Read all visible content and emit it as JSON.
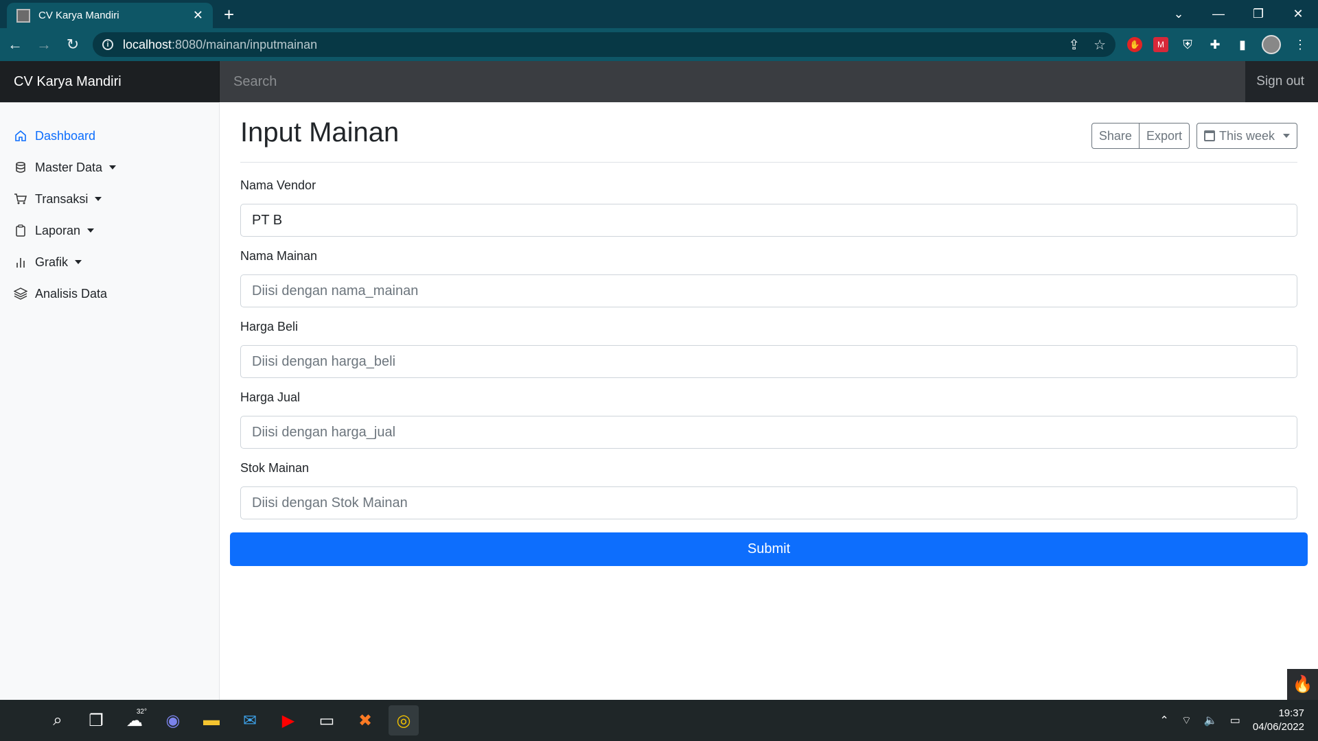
{
  "browser": {
    "tab_title": "CV Karya Mandiri",
    "url_host": "localhost",
    "url_path": ":8080/mainan/inputmainan"
  },
  "app": {
    "brand": "CV Karya Mandiri",
    "search_placeholder": "Search",
    "signout_label": "Sign out"
  },
  "sidebar": {
    "items": [
      {
        "label": "Dashboard",
        "icon": "home-icon",
        "active": true
      },
      {
        "label": "Master Data",
        "icon": "database-icon",
        "dropdown": true
      },
      {
        "label": "Transaksi",
        "icon": "cart-icon",
        "dropdown": true
      },
      {
        "label": "Laporan",
        "icon": "clipboard-icon",
        "dropdown": true
      },
      {
        "label": "Grafik",
        "icon": "bar-chart-icon",
        "dropdown": true
      },
      {
        "label": "Analisis Data",
        "icon": "layers-icon"
      }
    ]
  },
  "page": {
    "title": "Input Mainan",
    "share_label": "Share",
    "export_label": "Export",
    "period_label": "This week"
  },
  "form": {
    "fields": [
      {
        "label": "Nama Vendor",
        "value": "PT B",
        "placeholder": ""
      },
      {
        "label": "Nama Mainan",
        "value": "",
        "placeholder": "Diisi dengan nama_mainan"
      },
      {
        "label": "Harga Beli",
        "value": "",
        "placeholder": "Diisi dengan harga_beli"
      },
      {
        "label": "Harga Jual",
        "value": "",
        "placeholder": "Diisi dengan harga_jual"
      },
      {
        "label": "Stok Mainan",
        "value": "",
        "placeholder": "Diisi dengan Stok Mainan"
      }
    ],
    "submit_label": "Submit"
  },
  "taskbar": {
    "weather": "32°",
    "time": "19:37",
    "date": "04/06/2022"
  },
  "colors": {
    "primary": "#0d6efd",
    "navbar": "#212529",
    "chrome": "#0e5666"
  }
}
